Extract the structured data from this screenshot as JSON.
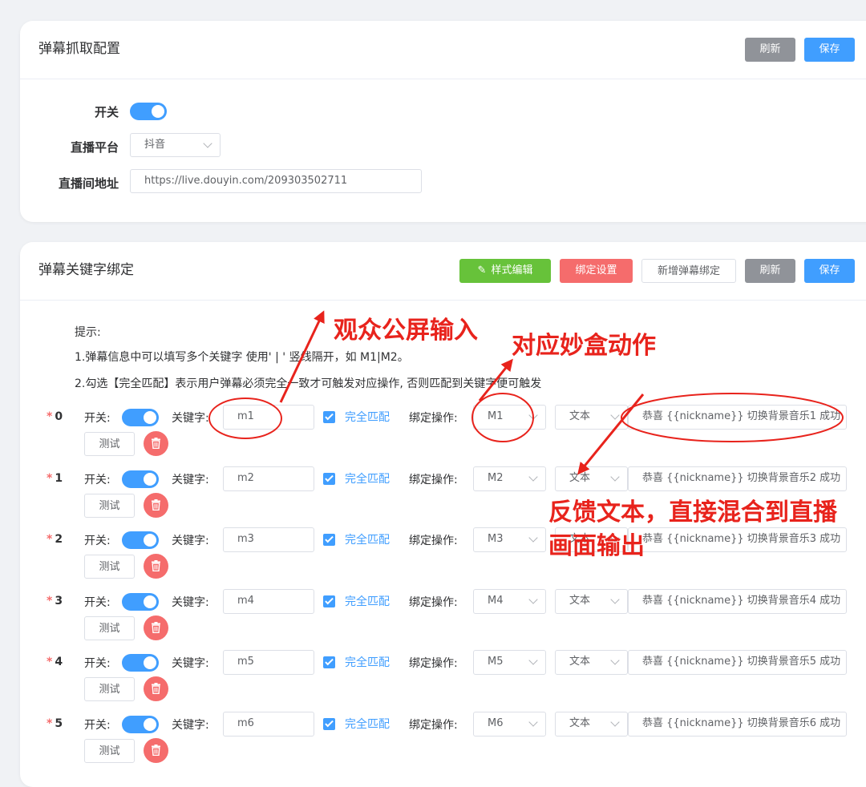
{
  "capture": {
    "title": "弹幕抓取配置",
    "refresh_label": "刷新",
    "save_label": "保存",
    "switch_label": "开关",
    "platform_label": "直播平台",
    "platform_value": "抖音",
    "url_label": "直播间地址",
    "url_value": "https://live.douyin.com/209303502711"
  },
  "binding": {
    "title": "弹幕关键字绑定",
    "style_edit_label": "样式编辑",
    "bind_settings_label": "绑定设置",
    "add_binding_label": "新增弹幕绑定",
    "refresh_label": "刷新",
    "save_label": "保存",
    "tips_title": "提示:",
    "tip1": "1.弹幕信息中可以填写多个关键字 使用' | ' 竖线隔开，如 M1|M2。",
    "tip2": "2.勾选【完全匹配】表示用户弹幕必须完全一致才可触发对应操作, 否则匹配到关键字便可触发",
    "switch_label": "开关:",
    "keyword_label": "关键字:",
    "exact_match_label": "完全匹配",
    "action_label": "绑定操作:",
    "test_label": "测试",
    "rows": [
      {
        "index": "0",
        "keyword": "m1",
        "action": "M1",
        "type": "文本",
        "feedback": "恭喜 {{nickname}} 切换背景音乐1 成功"
      },
      {
        "index": "1",
        "keyword": "m2",
        "action": "M2",
        "type": "文本",
        "feedback": "恭喜 {{nickname}} 切换背景音乐2 成功"
      },
      {
        "index": "2",
        "keyword": "m3",
        "action": "M3",
        "type": "文本",
        "feedback": "恭喜 {{nickname}} 切换背景音乐3 成功"
      },
      {
        "index": "3",
        "keyword": "m4",
        "action": "M4",
        "type": "文本",
        "feedback": "恭喜 {{nickname}} 切换背景音乐4 成功"
      },
      {
        "index": "4",
        "keyword": "m5",
        "action": "M5",
        "type": "文本",
        "feedback": "恭喜 {{nickname}} 切换背景音乐5 成功"
      },
      {
        "index": "5",
        "keyword": "m6",
        "action": "M6",
        "type": "文本",
        "feedback": "恭喜 {{nickname}} 切换背景音乐6 成功"
      }
    ]
  },
  "annotations": {
    "audience_input": "观众公屏输入",
    "box_action": "对应妙盒动作",
    "feedback_line1": "反馈文本，直接混合到直播",
    "feedback_line2": "画面输出"
  },
  "colors": {
    "primary": "#409eff",
    "annotation": "#e8231c"
  }
}
